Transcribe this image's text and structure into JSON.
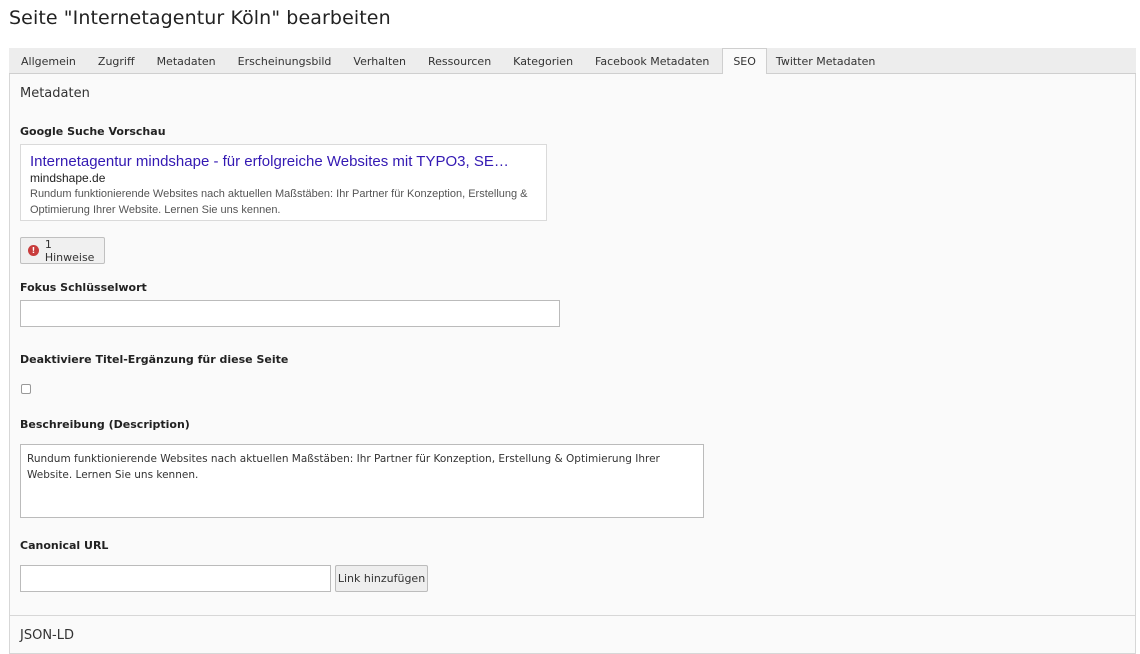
{
  "page": {
    "title": "Seite \"Internetagentur Köln\" bearbeiten"
  },
  "tabs": [
    {
      "label": "Allgemein"
    },
    {
      "label": "Zugriff"
    },
    {
      "label": "Metadaten"
    },
    {
      "label": "Erscheinungsbild"
    },
    {
      "label": "Verhalten"
    },
    {
      "label": "Ressourcen"
    },
    {
      "label": "Kategorien"
    },
    {
      "label": "Facebook Metadaten"
    },
    {
      "label": "SEO",
      "active": true
    },
    {
      "label": "Twitter Metadaten"
    }
  ],
  "metadata_section": {
    "title": "Metadaten"
  },
  "google_preview": {
    "label": "Google Suche Vorschau",
    "title": "Internetagentur mindshape - für erfolgreiche Websites mit TYPO3, SE…",
    "url": "mindshape.de",
    "description": "Rundum funktionierende Websites nach aktuellen Maßstäben: Ihr Partner für Konzeption, Erstellung & Optimierung Ihrer Website. Lernen Sie uns kennen."
  },
  "hints": {
    "label": "1 Hinweise",
    "icon": "exclamation-circle-icon",
    "color": "#c83c3c"
  },
  "focus_keyword": {
    "label": "Fokus Schlüsselwort",
    "value": ""
  },
  "disable_title_suffix": {
    "label": "Deaktiviere Titel-Ergänzung für diese Seite",
    "checked": false
  },
  "description": {
    "label": "Beschreibung (Description)",
    "value": "Rundum funktionierende Websites nach aktuellen Maßstäben: Ihr Partner für Konzeption, Erstellung & Optimierung Ihrer Website. Lernen Sie uns kennen."
  },
  "canonical": {
    "label": "Canonical URL",
    "value": "",
    "button_label": "Link hinzufügen"
  },
  "jsonld_section": {
    "title": "JSON-LD"
  }
}
